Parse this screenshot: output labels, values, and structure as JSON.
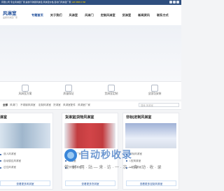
{
  "topbar": {
    "text": "有限公司 专业风淋室厂家,提供不锈钢风淋室,风淋室价格,自动门风淋室厂家",
    "phone": "138 8888 6788"
  },
  "header": {
    "logo_name": "风淋室",
    "logo_sub": "品质风淋室厂家",
    "nav": [
      "专题首页",
      "关于我们",
      "风淋室",
      "风淋门",
      "定制风淋室",
      "货淋室",
      "新闻资讯",
      "联系方式"
    ]
  },
  "services": [
    {
      "label": "风淋室方案"
    },
    {
      "label": "质量保证"
    },
    {
      "label": "货淋室定制"
    },
    {
      "label": "全国包安装"
    }
  ],
  "tabs": {
    "items": [
      "全部",
      "风淋门",
      "不锈钢风淋室",
      "定制风淋室",
      "货淋室",
      "风淋室配件",
      "风淋室厂家"
    ],
    "search_placeholder": "搜索 风淋室"
  },
  "cards": [
    {
      "title": "淋室",
      "features": [
        "双人风淋室",
        "自动感应风淋室",
        "过位风淋室"
      ],
      "more": "查看更多风淋室"
    },
    {
      "title": "货淋室|货物风淋室",
      "features": [
        "风淋室厂家",
        "货淋室",
        "货物风淋室"
      ],
      "more": "查看更多货淋室"
    },
    {
      "title": "非标|定制风淋室",
      "features": [
        "非标风淋室",
        "L型风淋室",
        "U型风淋室"
      ],
      "more": "查看更多定制风淋室"
    }
  ],
  "watermark": {
    "big": "自动秒收录",
    "small": "做 · 好 · 网 · 站 — 来 · 访 · 一 · 次 — 自 · 动 · 收 · 录"
  }
}
